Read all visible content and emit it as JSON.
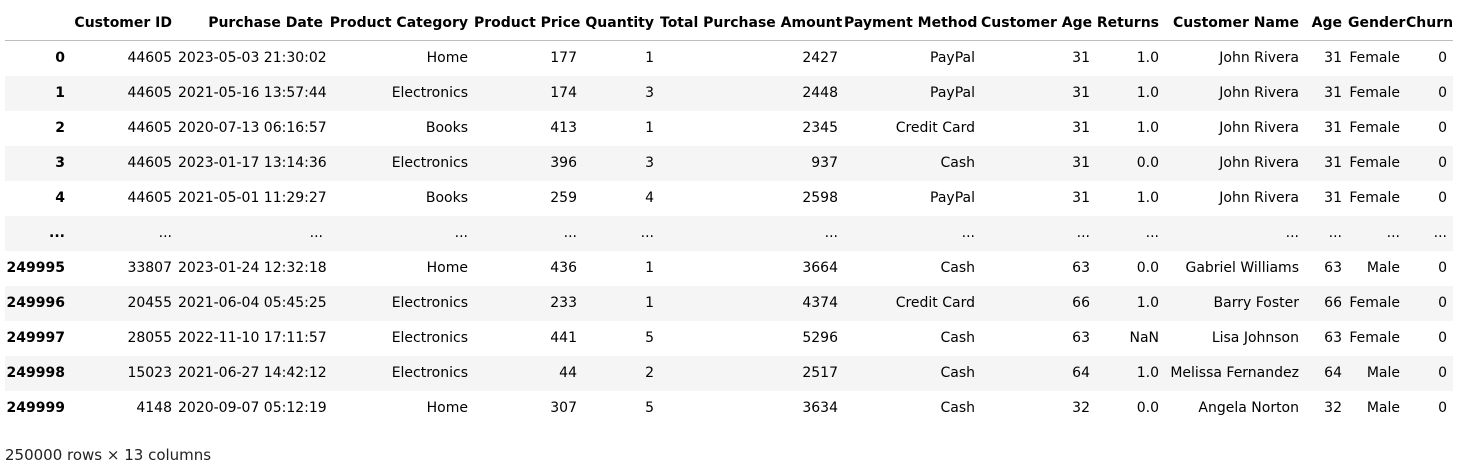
{
  "table": {
    "index_header": "",
    "columns": [
      "Customer ID",
      "Purchase Date",
      "Product Category",
      "Product Price",
      "Quantity",
      "Total Purchase Amount",
      "Payment Method",
      "Customer Age",
      "Returns",
      "Customer Name",
      "Age",
      "Gender",
      "Churn"
    ],
    "rows": [
      {
        "index": "0",
        "cells": [
          "44605",
          "2023-05-03 21:30:02",
          "Home",
          "177",
          "1",
          "2427",
          "PayPal",
          "31",
          "1.0",
          "John Rivera",
          "31",
          "Female",
          "0"
        ]
      },
      {
        "index": "1",
        "cells": [
          "44605",
          "2021-05-16 13:57:44",
          "Electronics",
          "174",
          "3",
          "2448",
          "PayPal",
          "31",
          "1.0",
          "John Rivera",
          "31",
          "Female",
          "0"
        ]
      },
      {
        "index": "2",
        "cells": [
          "44605",
          "2020-07-13 06:16:57",
          "Books",
          "413",
          "1",
          "2345",
          "Credit Card",
          "31",
          "1.0",
          "John Rivera",
          "31",
          "Female",
          "0"
        ]
      },
      {
        "index": "3",
        "cells": [
          "44605",
          "2023-01-17 13:14:36",
          "Electronics",
          "396",
          "3",
          "937",
          "Cash",
          "31",
          "0.0",
          "John Rivera",
          "31",
          "Female",
          "0"
        ]
      },
      {
        "index": "4",
        "cells": [
          "44605",
          "2021-05-01 11:29:27",
          "Books",
          "259",
          "4",
          "2598",
          "PayPal",
          "31",
          "1.0",
          "John Rivera",
          "31",
          "Female",
          "0"
        ]
      },
      {
        "index": "...",
        "cells": [
          "...",
          "...",
          "...",
          "...",
          "...",
          "...",
          "...",
          "...",
          "...",
          "...",
          "...",
          "...",
          "..."
        ]
      },
      {
        "index": "249995",
        "cells": [
          "33807",
          "2023-01-24 12:32:18",
          "Home",
          "436",
          "1",
          "3664",
          "Cash",
          "63",
          "0.0",
          "Gabriel Williams",
          "63",
          "Male",
          "0"
        ]
      },
      {
        "index": "249996",
        "cells": [
          "20455",
          "2021-06-04 05:45:25",
          "Electronics",
          "233",
          "1",
          "4374",
          "Credit Card",
          "66",
          "1.0",
          "Barry Foster",
          "66",
          "Female",
          "0"
        ]
      },
      {
        "index": "249997",
        "cells": [
          "28055",
          "2022-11-10 17:11:57",
          "Electronics",
          "441",
          "5",
          "5296",
          "Cash",
          "63",
          "NaN",
          "Lisa Johnson",
          "63",
          "Female",
          "0"
        ]
      },
      {
        "index": "249998",
        "cells": [
          "15023",
          "2021-06-27 14:42:12",
          "Electronics",
          "44",
          "2",
          "2517",
          "Cash",
          "64",
          "1.0",
          "Melissa Fernandez",
          "64",
          "Male",
          "0"
        ]
      },
      {
        "index": "249999",
        "cells": [
          "4148",
          "2020-09-07 05:12:19",
          "Home",
          "307",
          "5",
          "3634",
          "Cash",
          "32",
          "0.0",
          "Angela Norton",
          "32",
          "Male",
          "0"
        ]
      }
    ]
  },
  "caption": "250000 rows × 13 columns",
  "colors": {
    "stripe": "#f5f5f5",
    "header_rule": "#bdbdbd",
    "text": "#000000"
  }
}
